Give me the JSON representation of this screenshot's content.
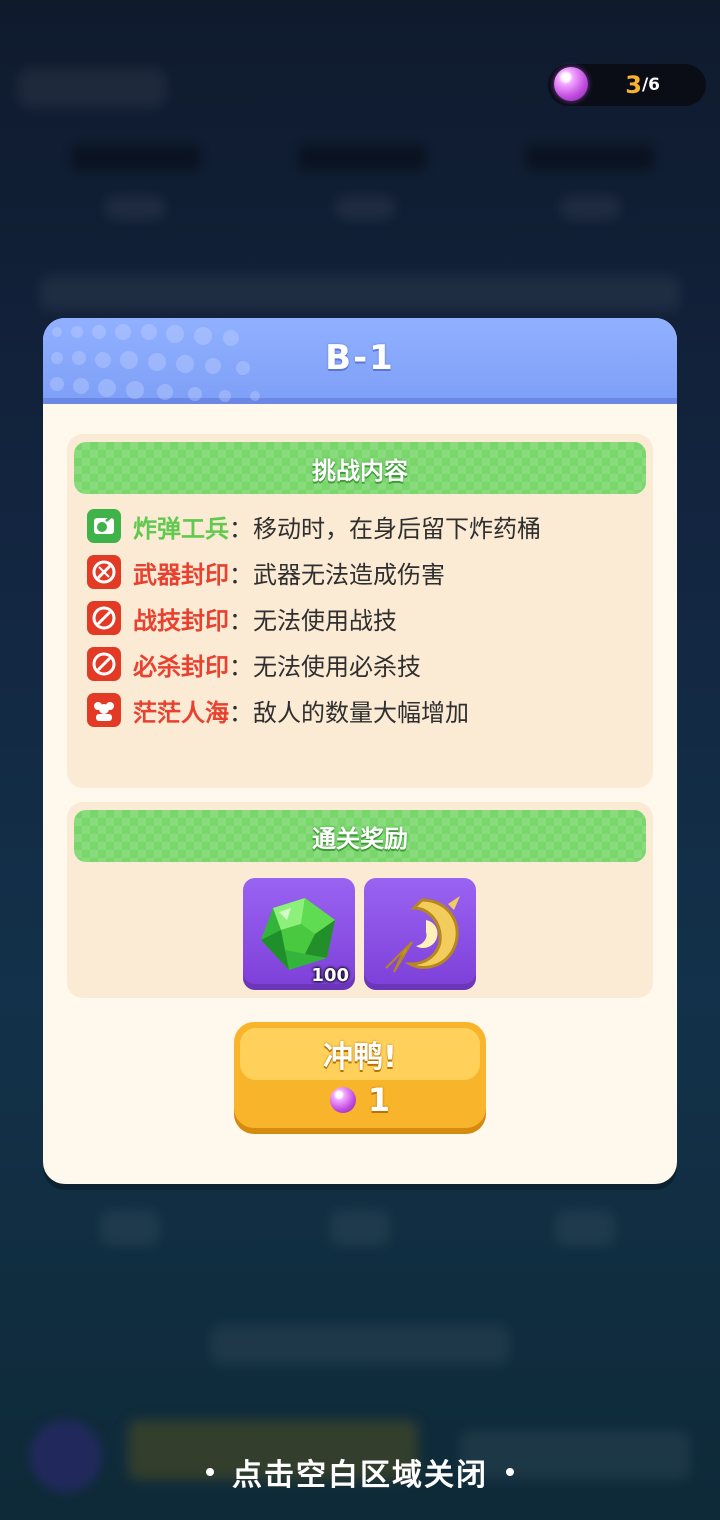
{
  "counter": {
    "current": "3",
    "max": "/6"
  },
  "modal": {
    "title": "B-1",
    "challenge": {
      "header": "挑战内容",
      "rules": [
        {
          "name": "炸弹工兵",
          "sep": "：",
          "desc": "移动时，在身后留下炸药桶",
          "color": "#61c94f",
          "icon": "bomb-sapper-icon"
        },
        {
          "name": "武器封印",
          "sep": "：",
          "desc": "武器无法造成伤害",
          "color": "#e8412f",
          "icon": "weapon-seal-icon"
        },
        {
          "name": "战技封印",
          "sep": "：",
          "desc": "无法使用战技",
          "color": "#e8412f",
          "icon": "skill-seal-icon"
        },
        {
          "name": "必杀封印",
          "sep": "：",
          "desc": "无法使用必杀技",
          "color": "#e8412f",
          "icon": "ultimate-seal-icon"
        },
        {
          "name": "茫茫人海",
          "sep": "：",
          "desc": "敌人的数量大幅增加",
          "color": "#e8412f",
          "icon": "crowd-icon"
        }
      ]
    },
    "rewards": {
      "header": "通关奖励",
      "items": [
        {
          "icon": "green-gem-icon",
          "count": "100"
        },
        {
          "icon": "golden-crescent-icon",
          "count": ""
        }
      ]
    },
    "go_button": {
      "label": "冲鸭!",
      "cost": "1"
    }
  },
  "hint": "点击空白区域关闭"
}
